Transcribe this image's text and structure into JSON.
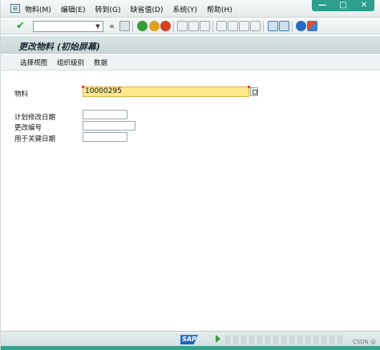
{
  "menubar": {
    "items": [
      {
        "label": "物料(M)"
      },
      {
        "label": "编辑(E)"
      },
      {
        "label": "转到(G)"
      },
      {
        "label": "缺省值(D)"
      },
      {
        "label": "系统(Y)"
      },
      {
        "label": "帮助(H)"
      }
    ]
  },
  "window_controls": {
    "minimize": "—",
    "maximize": "□",
    "close": "✕"
  },
  "toolbar": {
    "command_field_value": "",
    "back_glyph": "«",
    "icons": [
      "check-icon",
      "save-icon",
      "back-icon",
      "exit-icon",
      "cancel-icon",
      "print-icon",
      "find-icon",
      "find-next-icon",
      "first-page-icon",
      "prev-page-icon",
      "next-page-icon",
      "last-page-icon",
      "new-session-icon",
      "shortcut-icon",
      "help-icon",
      "layout-icon"
    ]
  },
  "title": "更改物料 (初始屏幕)",
  "app_toolbar": {
    "buttons": [
      "选择视图",
      "组织级别",
      "数据"
    ]
  },
  "form": {
    "material_label": "物料",
    "material_value": "10000295",
    "planned_change_date_label": "计划修改日期",
    "planned_change_date_value": "",
    "change_number_label": "更改编号",
    "change_number_value": "",
    "key_date_label": "用于关键日期",
    "key_date_value": ""
  },
  "statusbar": {
    "logo": "SAP",
    "watermark": "CSDN @"
  }
}
